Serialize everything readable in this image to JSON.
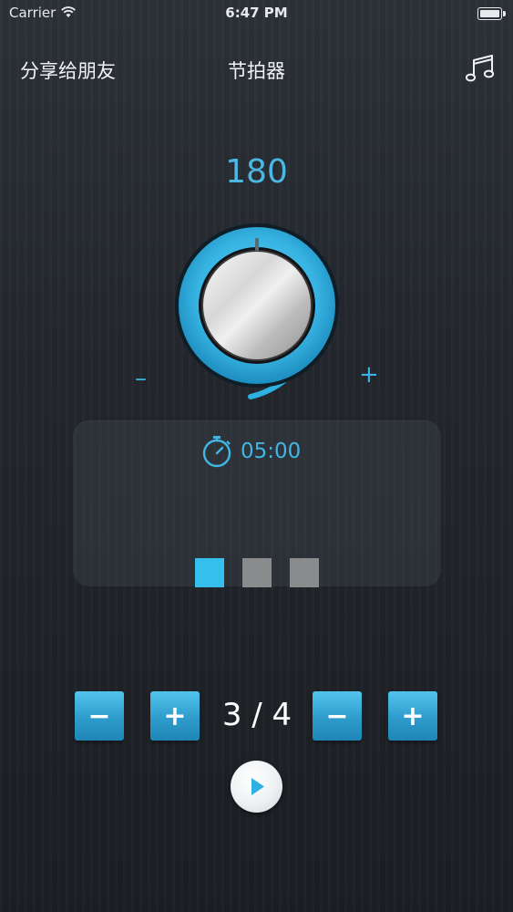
{
  "status_bar": {
    "carrier": "Carrier",
    "time": "6:47 PM"
  },
  "nav": {
    "share_label": "分享给朋友",
    "title": "节拍器",
    "music_icon": "music-notes-icon"
  },
  "tempo": {
    "bpm": "180",
    "decrease_symbol": "–",
    "increase_symbol": "+"
  },
  "timer": {
    "icon": "stopwatch-icon",
    "value": "05:00"
  },
  "beats": {
    "count": 3,
    "active_index": 0,
    "active_color": "#35c0eb",
    "inactive_color": "#8a8b8d"
  },
  "time_signature": {
    "value": "3 / 4",
    "beats_minus": "−",
    "beats_plus": "+",
    "note_minus": "−",
    "note_plus": "+"
  },
  "colors": {
    "accent": "#3fb6e3"
  },
  "controls": {
    "play_icon": "play-icon"
  }
}
